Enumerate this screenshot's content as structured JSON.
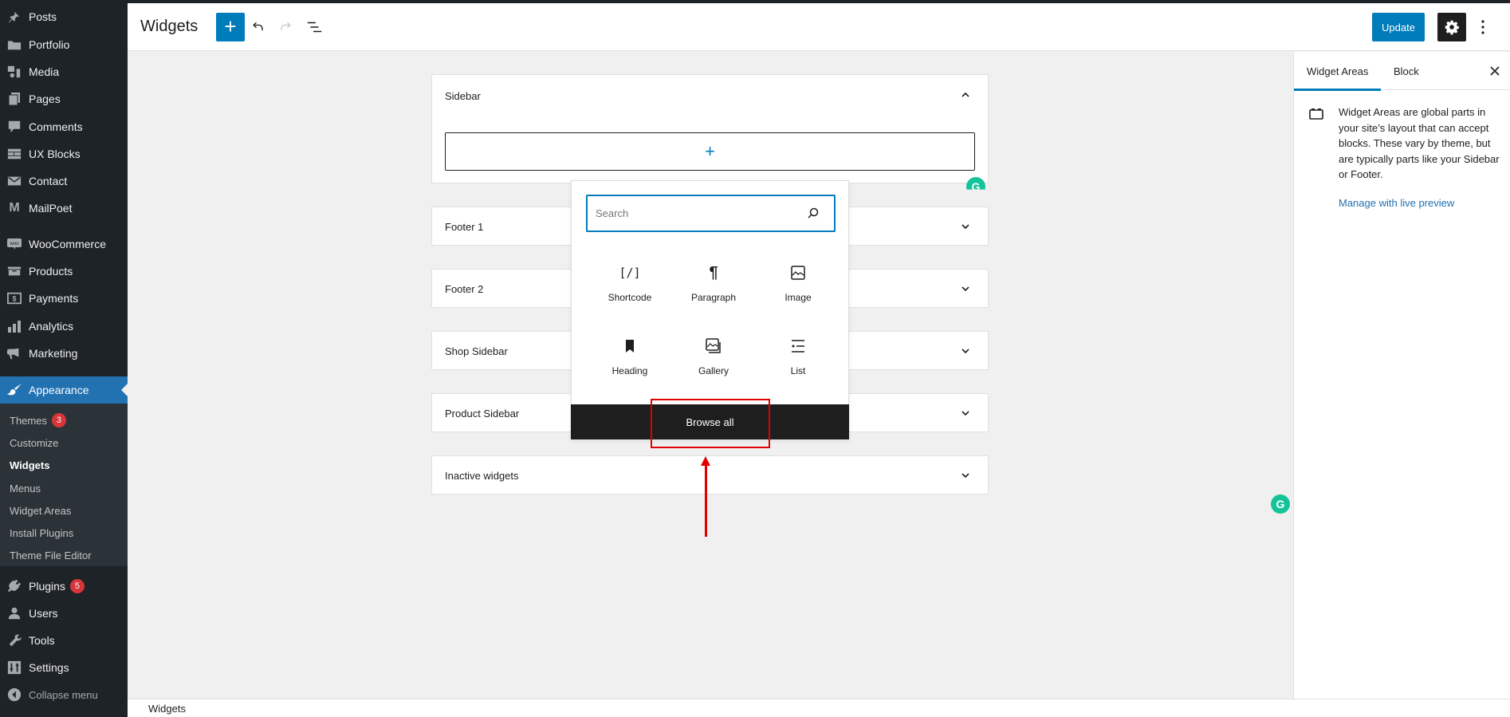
{
  "admin_menu": {
    "items": [
      {
        "label": "Posts",
        "icon": "pin-icon"
      },
      {
        "label": "Portfolio",
        "icon": "folder-icon"
      },
      {
        "label": "Media",
        "icon": "media-icon"
      },
      {
        "label": "Pages",
        "icon": "pages-icon"
      },
      {
        "label": "Comments",
        "icon": "comment-icon"
      },
      {
        "label": "UX Blocks",
        "icon": "blocks-icon"
      },
      {
        "label": "Contact",
        "icon": "envelope-icon"
      },
      {
        "label": "MailPoet",
        "icon": "mailpoet-icon"
      },
      {
        "label": "WooCommerce",
        "icon": "woo-icon"
      },
      {
        "label": "Products",
        "icon": "archive-icon"
      },
      {
        "label": "Payments",
        "icon": "dollar-icon"
      },
      {
        "label": "Analytics",
        "icon": "bar-chart-icon"
      },
      {
        "label": "Marketing",
        "icon": "megaphone-icon"
      },
      {
        "label": "Appearance",
        "icon": "brush-icon"
      },
      {
        "label": "Plugins",
        "icon": "plug-icon",
        "badge": "5"
      },
      {
        "label": "Users",
        "icon": "user-icon"
      },
      {
        "label": "Tools",
        "icon": "wrench-icon"
      },
      {
        "label": "Settings",
        "icon": "sliders-icon"
      }
    ],
    "submenu": [
      {
        "label": "Themes",
        "badge": "3"
      },
      {
        "label": "Customize"
      },
      {
        "label": "Widgets"
      },
      {
        "label": "Menus"
      },
      {
        "label": "Widget Areas"
      },
      {
        "label": "Install Plugins"
      },
      {
        "label": "Theme File Editor"
      }
    ],
    "collapse_label": "Collapse menu"
  },
  "header": {
    "title": "Widgets",
    "add_label": "+",
    "update_label": "Update"
  },
  "widget_areas": [
    {
      "title": "Sidebar",
      "expanded": true
    },
    {
      "title": "Footer 1",
      "expanded": false
    },
    {
      "title": "Footer 2",
      "expanded": false
    },
    {
      "title": "Shop Sidebar",
      "expanded": false
    },
    {
      "title": "Product Sidebar",
      "expanded": false
    },
    {
      "title": "Inactive widgets",
      "expanded": false
    }
  ],
  "inserter": {
    "search_placeholder": "Search",
    "search_value": "",
    "blocks": [
      {
        "label": "Shortcode",
        "icon": "shortcode-icon"
      },
      {
        "label": "Paragraph",
        "icon": "paragraph-icon"
      },
      {
        "label": "Image",
        "icon": "image-icon"
      },
      {
        "label": "Heading",
        "icon": "bookmark-icon"
      },
      {
        "label": "Gallery",
        "icon": "gallery-icon"
      },
      {
        "label": "List",
        "icon": "list-icon"
      }
    ],
    "browse_all_label": "Browse all"
  },
  "settings_panel": {
    "tabs": [
      "Widget Areas",
      "Block"
    ],
    "active_tab": "Widget Areas",
    "description": "Widget Areas are global parts in your site’s layout that can accept blocks. These vary by theme, but are typically parts like your Sidebar or Footer.",
    "link_label": "Manage with live preview"
  },
  "footer": {
    "breadcrumb": "Widgets"
  },
  "colors": {
    "accent": "#007cba",
    "admin_bg": "#1d2327",
    "admin_current": "#2271b1",
    "badge": "#d63638",
    "annotation": "#e00000"
  }
}
